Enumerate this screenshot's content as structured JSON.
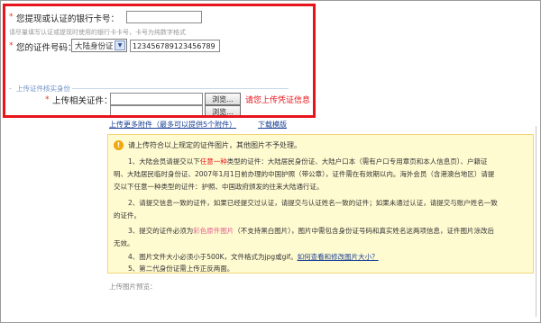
{
  "form": {
    "bank_card_label": "您提现或认证的银行卡号：",
    "bank_card_value": "",
    "bank_card_hint": "请尽量填写认证或提现时使用的银行卡卡号，卡号为纯数字格式",
    "id_label": "您的证件号码：",
    "id_type_selected": "大陆身份证",
    "id_value": "123456789123456789",
    "section_title": "上传证件核实身份",
    "upload_label": "上传相关证件：",
    "browse_label": "浏览...",
    "upload_hint": "请您上传凭证信息",
    "more_link": "上传更多附件（最多可以提供5个附件）",
    "download_link": "下载模版"
  },
  "notice": {
    "title": "请上传符合以上规定的证件图片，其他图片不予处理。",
    "p1_a": "1、大陆会员请提交以下",
    "p1_em": "任意一种",
    "p1_b": "类型的证件：大陆居民身份证、大陆户口本（需有户口专用章页和本人信息页）、户籍证",
    "p1_c": "明、大陆居民临时身份证、2007年1月1日前办理的中国护照（带公章），证件需在有效期以内。海外会员（含港澳台地区）请提",
    "p1_d": "交以下任意一种类型的证件：护照、中国政府颁发的往来大陆通行证。",
    "p2_a": "2、请提交信息一致的证件，如果已经提交过认证，请提交与认证姓名一致的证件；如果未通过认证，请提交与账户姓名一致",
    "p2_b": "的证件。",
    "p3_a": "3、提交的证件必须为",
    "p3_em": "彩色原件图片",
    "p3_b": "（不支持黑白图片），图片中需包含身份证号码和真实姓名这两项信息，证件图片涂改后",
    "p3_c": "无效。",
    "p4_a": "4、图片文件大小必须小于500K，文件格式为jpg或gif。",
    "p4_link": "如何查看和修改图片大小？",
    "p5": "5、第二代身份证需上传正反两面。"
  },
  "preview_label": "上传图片预览：",
  "colors": {
    "highlight": "#e8141b",
    "notice_bg": "#fffbd1",
    "link": "#1a3f94"
  }
}
